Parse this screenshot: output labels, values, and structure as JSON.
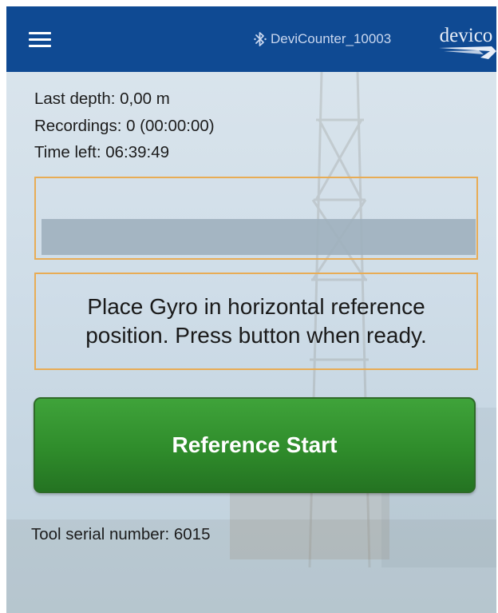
{
  "app_bar": {
    "menu_icon": "hamburger-menu-icon",
    "bluetooth_icon": "bluetooth-icon",
    "device_name": "DeviCounter_10003",
    "logo_text": "devico",
    "background_color": "#0f4a93"
  },
  "status": {
    "last_depth": "Last depth: 0,00 m",
    "recordings": "Recordings: 0 (00:00:00)",
    "time_left": "Time left: 06:39:49"
  },
  "progress": {
    "value": 0,
    "accent_color": "#e8ac55"
  },
  "message": {
    "text": "Place Gyro in horizontal reference position. Press button when ready."
  },
  "action": {
    "start_label": "Reference Start",
    "button_color": "#2f8c2b"
  },
  "footer": {
    "serial_number": "Tool serial number: 6015"
  }
}
